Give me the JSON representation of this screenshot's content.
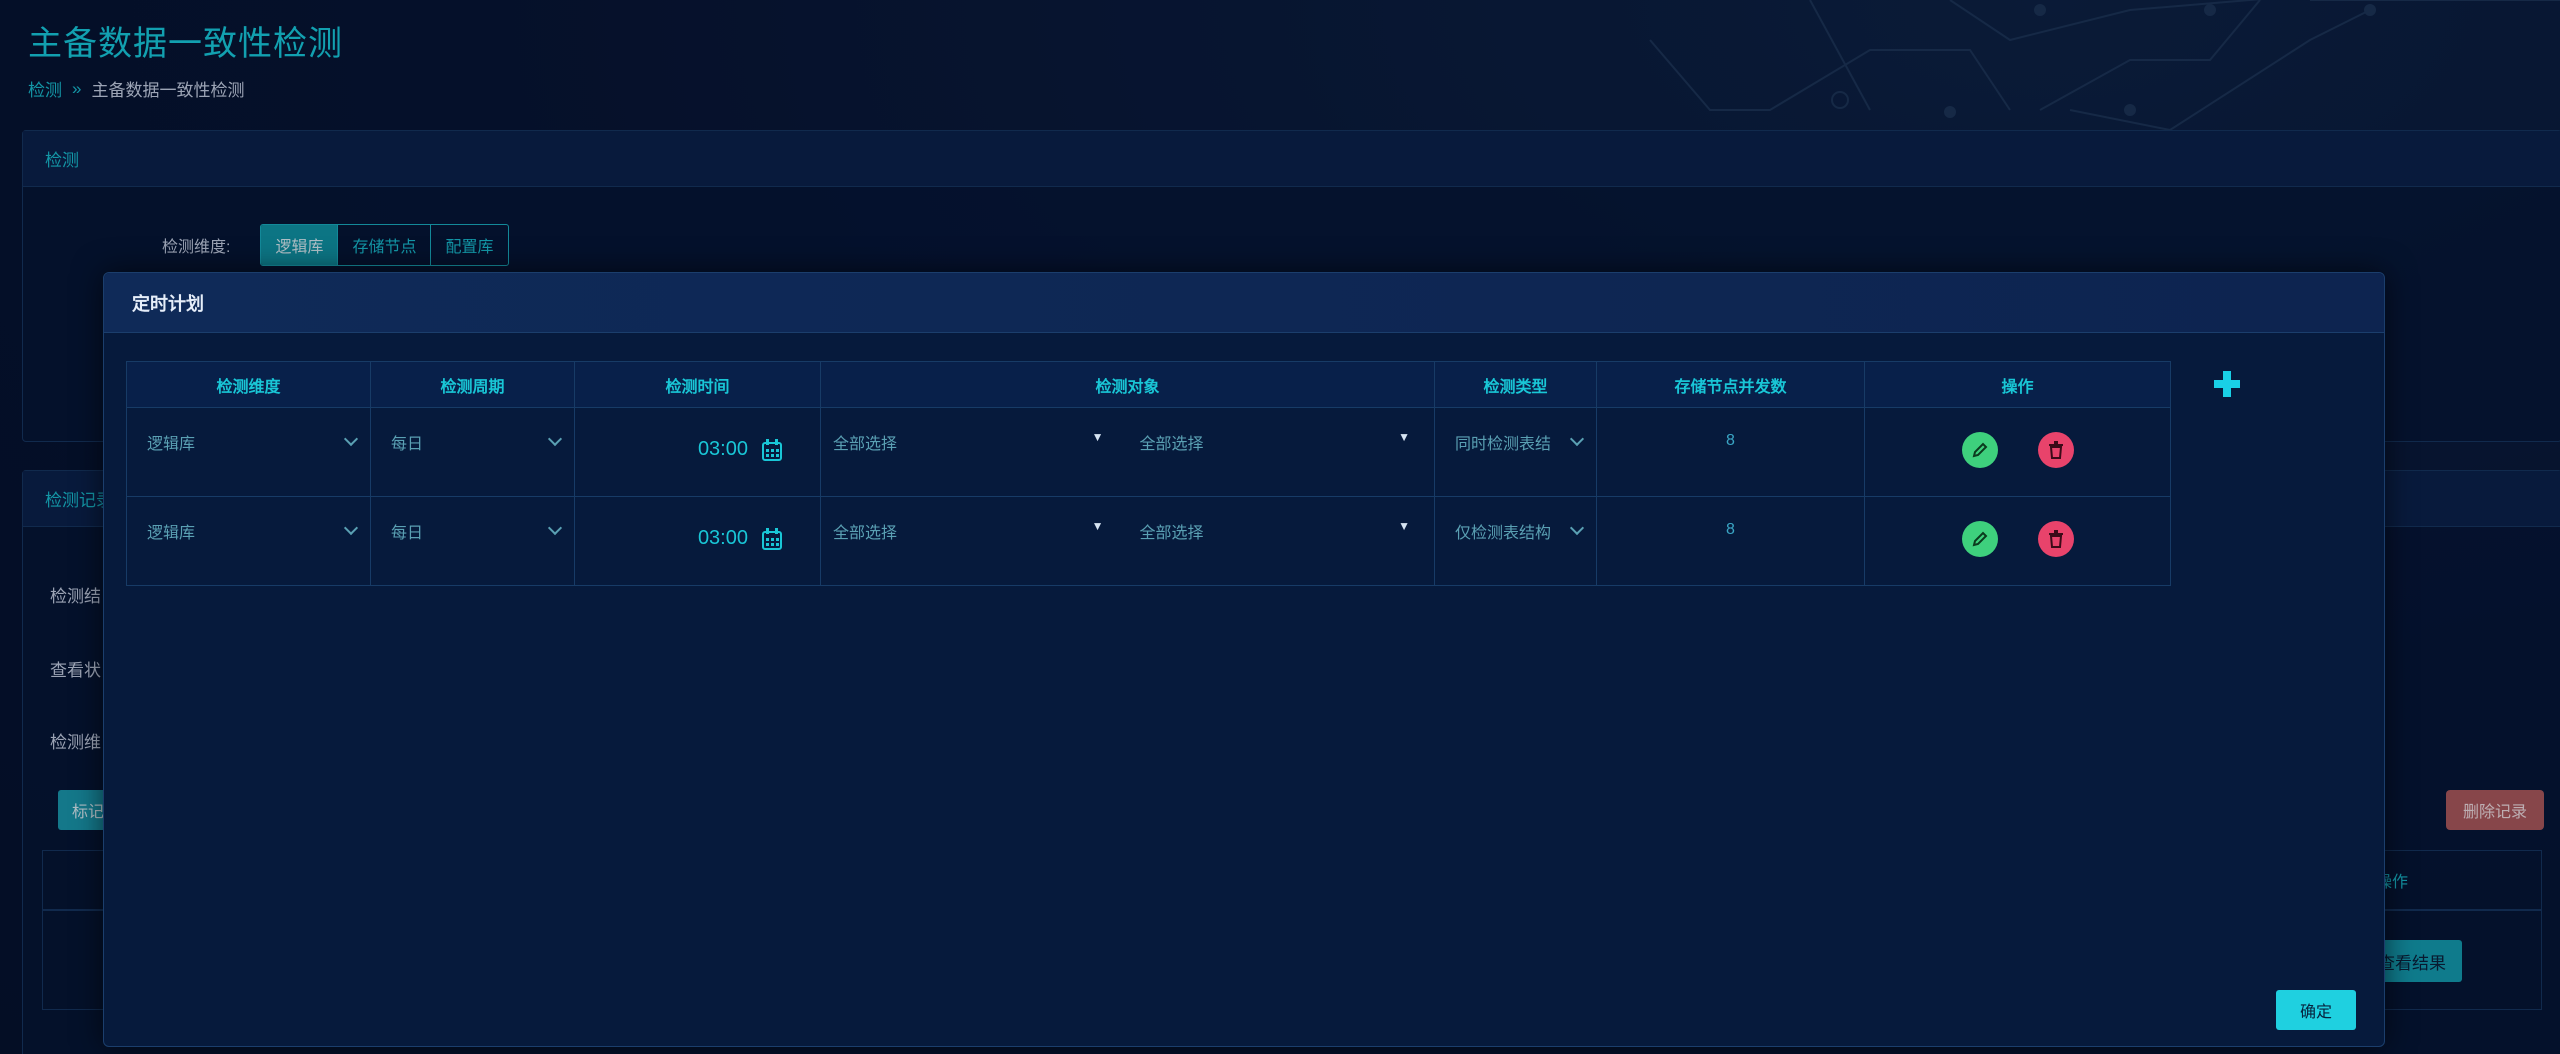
{
  "page": {
    "title": "主备数据一致性检测",
    "breadcrumb": {
      "root": "检测",
      "separator": "»",
      "current": "主备数据一致性检测"
    }
  },
  "detect_panel": {
    "title": "检测",
    "dimension_label": "检测维度:",
    "dimension_options": [
      "逻辑库",
      "存储节点",
      "配置库"
    ],
    "selected_option": "逻辑库"
  },
  "record_panel": {
    "title": "检测记录",
    "labels": [
      "检测结",
      "查看状",
      "检测维"
    ],
    "primary_button_stub": "标记",
    "delete_button": "删除记录",
    "op_header": "操作",
    "view_result_button": "查看结果"
  },
  "modal": {
    "title": "定时计划",
    "columns": [
      "检测维度",
      "检测周期",
      "检测时间",
      "检测对象",
      "检测类型",
      "存储节点并发数",
      "操作"
    ],
    "rows": [
      {
        "dimension": "逻辑库",
        "period": "每日",
        "time": "03:00",
        "object_a": "全部选择",
        "object_b": "全部选择",
        "type": "同时检测表结",
        "concurrency": "8"
      },
      {
        "dimension": "逻辑库",
        "period": "每日",
        "time": "03:00",
        "object_a": "全部选择",
        "object_b": "全部选择",
        "type": "仅检测表结构",
        "concurrency": "8"
      }
    ],
    "confirm_label": "确定"
  },
  "colors": {
    "accent": "#19c6d6",
    "edit": "#3ed07d",
    "delete": "#e8436b",
    "background": "#061330"
  },
  "icons": [
    "calendar-icon",
    "pencil-icon",
    "trash-icon",
    "plus-icon",
    "chevron-down-icon"
  ]
}
